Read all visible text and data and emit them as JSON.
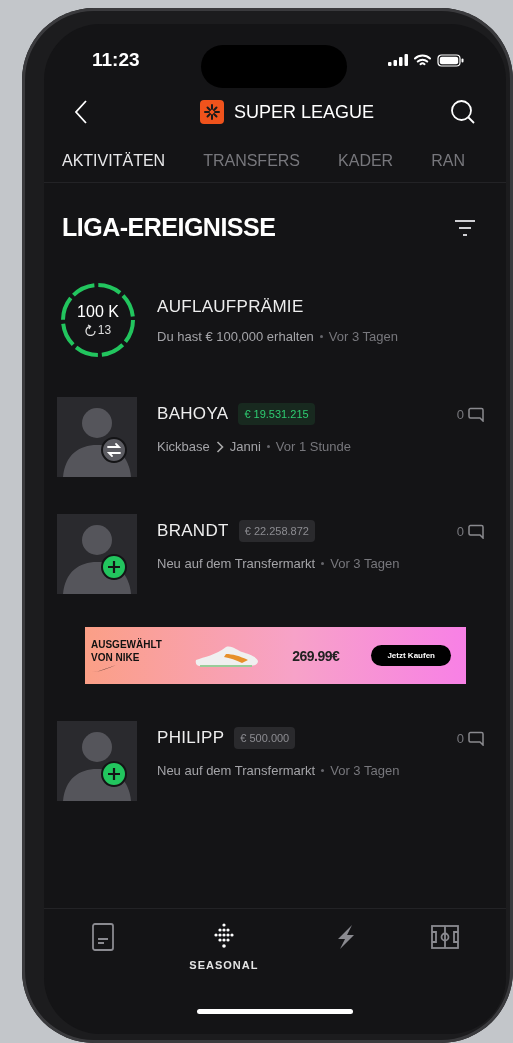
{
  "status_bar": {
    "time": "11:23"
  },
  "header": {
    "title": "SUPER LEAGUE"
  },
  "tabs": [
    {
      "label": "AKTIVITÄTEN",
      "selected": true
    },
    {
      "label": "TRANSFERS",
      "selected": false
    },
    {
      "label": "KADER",
      "selected": false
    },
    {
      "label": "RAN",
      "selected": false
    }
  ],
  "section": {
    "title": "LIGA-EREIGNISSE"
  },
  "events": [
    {
      "kind": "bonus",
      "amount": "100 K",
      "streak": "13",
      "title": "AUFLAUFPRÄMIE",
      "text": "Du hast € 100,000 erhalten",
      "time": "Vor 3 Tagen"
    },
    {
      "kind": "transfer",
      "name": "BAHOYA",
      "price": "€ 19.531.215",
      "price_up": true,
      "from": "Kickbase",
      "to": "Janni",
      "time": "Vor 1 Stunde",
      "comments": "0"
    },
    {
      "kind": "listing",
      "name": "BRANDT",
      "price": "€ 22.258.872",
      "price_up": false,
      "text": "Neu auf dem Transfermarkt",
      "time": "Vor 3 Tagen",
      "comments": "0"
    },
    {
      "kind": "ad",
      "lines": [
        "AUSGEWÄHLT",
        "VON NIKE"
      ],
      "price": "269.99€",
      "button": "Jetzt Kaufen"
    },
    {
      "kind": "listing",
      "name": "PHILIPP",
      "price": "€ 500.000",
      "price_up": false,
      "text": "Neu auf dem Transfermarkt",
      "time": "Vor 3 Tagen",
      "comments": "0"
    }
  ],
  "bottom_nav": [
    {
      "kind": "document",
      "selected": false
    },
    {
      "kind": "dots",
      "label": "SEASONAL",
      "selected": true
    },
    {
      "kind": "bolt",
      "selected": false
    },
    {
      "kind": "pitch",
      "selected": false
    }
  ]
}
